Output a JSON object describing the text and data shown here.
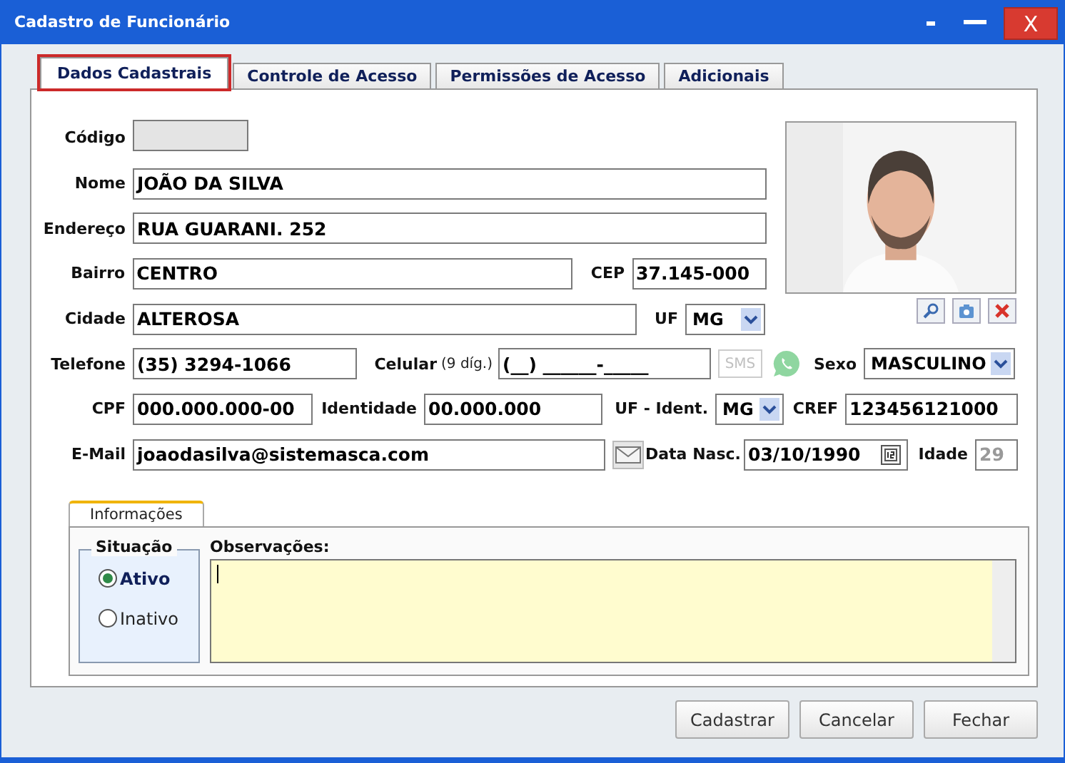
{
  "window": {
    "title": "Cadastro de Funcionário",
    "close": "X"
  },
  "tabs": [
    {
      "label": "Dados Cadastrais",
      "selected": true
    },
    {
      "label": "Controle de Acesso",
      "selected": false
    },
    {
      "label": "Permissões de Acesso",
      "selected": false
    },
    {
      "label": "Adicionais",
      "selected": false
    }
  ],
  "fields": {
    "codigo": {
      "label": "Código",
      "disabled": true
    },
    "nome": {
      "label": "Nome",
      "value": "JOÃO DA SILVA"
    },
    "endereco": {
      "label": "Endereço",
      "value": "RUA GUARANI. 252"
    },
    "bairro": {
      "label": "Bairro",
      "value": "CENTRO"
    },
    "cep": {
      "label": "CEP",
      "value": "37.145-000"
    },
    "cidade": {
      "label": "Cidade",
      "value": "ALTEROSA"
    },
    "uf": {
      "label": "UF",
      "value": "MG"
    },
    "telefone": {
      "label": "Telefone",
      "value": "(35) 3294-1066"
    },
    "celular": {
      "label": "Celular",
      "hint": "(9 díg.)",
      "value": "(__) ______-_____"
    },
    "sms": {
      "label": "SMS",
      "disabled": true
    },
    "sexo": {
      "label": "Sexo",
      "value": "MASCULINO"
    },
    "cpf": {
      "label": "CPF",
      "value": "000.000.000-00"
    },
    "identidade": {
      "label": "Identidade",
      "value": "00.000.000"
    },
    "uf_ident": {
      "label": "UF - Ident.",
      "value": "MG"
    },
    "cref": {
      "label": "CREF",
      "value": "123456121000"
    },
    "email": {
      "label": "E-Mail",
      "value": "joaodasilva@sistemasca.com"
    },
    "data_nasc": {
      "label": "Data Nasc.",
      "value": "03/10/1990"
    },
    "idade": {
      "label": "Idade",
      "value": "29",
      "disabled": true
    }
  },
  "photo": {
    "kind": "picture"
  },
  "info_tab": {
    "label": "Informações",
    "selected": true
  },
  "situacao": {
    "title": "Situação",
    "options": [
      {
        "label": "Ativo",
        "selected": true
      },
      {
        "label": "Inativo",
        "selected": false
      }
    ]
  },
  "observacoes": {
    "label": "Observações:"
  },
  "buttons": [
    "Cadastrar",
    "Cancelar",
    "Fechar"
  ]
}
